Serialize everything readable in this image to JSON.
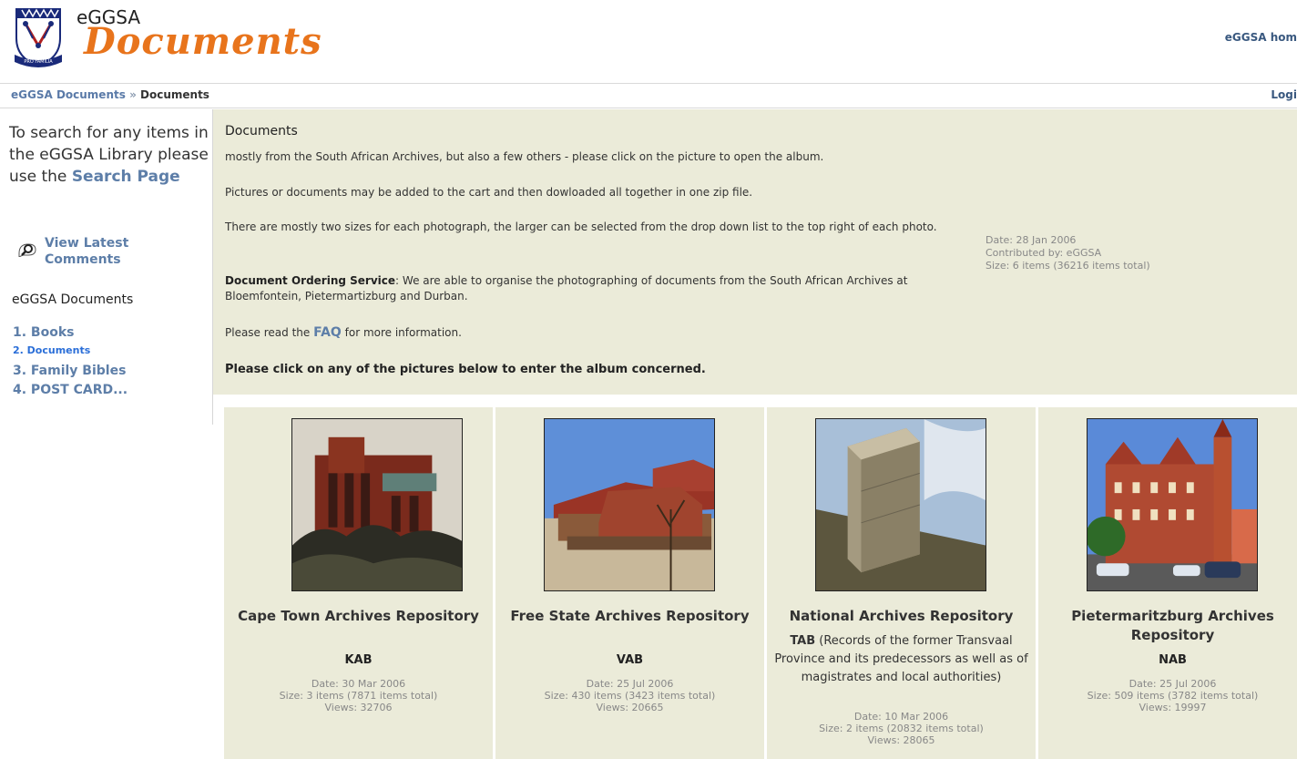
{
  "header": {
    "logo_small": "eGGSA",
    "logo_big": "Documents",
    "home_link": "eGGSA hom",
    "crest_motto": "PRO FAMILIA"
  },
  "breadcrumb": {
    "root": "eGGSA Documents",
    "separator": "»",
    "current": "Documents",
    "login": "Logi"
  },
  "sidebar": {
    "search_text": "To search for any items in the eGGSA Library please use the",
    "search_link": "Search Page",
    "latest_link": "View Latest Comments",
    "section_title": "eGGSA Documents",
    "items": [
      {
        "label": "1. Books"
      },
      {
        "label": "2. Documents"
      },
      {
        "label": "3. Family Bibles"
      },
      {
        "label": "4. POST CARD..."
      }
    ]
  },
  "intro": {
    "heading": "Documents",
    "p1": "mostly from the South African Archives, but also a few others - please click on the picture to open the album.",
    "p2": "Pictures or documents may be added to the cart and then dowloaded all together in one zip file.",
    "p3": "There are mostly two sizes for each photograph, the larger can be selected from the drop down list to the top right of each photo.",
    "p4_bold": "Document Ordering Service",
    "p4_rest": ": We are able to organise the photographing of documents from the South African Archives at Bloemfontein, Pietermartizburg and Durban.",
    "p5_pre": "Please read the ",
    "p5_link": "FAQ",
    "p5_post": " for more information.",
    "p6": "Please click on any of the pictures below to enter the album concerned.",
    "meta_date": "Date: 28 Jan 2006",
    "meta_contrib": "Contributed by: eGGSA",
    "meta_size": "Size: 6 items (36216 items total)"
  },
  "albums": [
    {
      "title": "Cape Town Archives Repository",
      "code": "KAB",
      "date": "Date: 30 Mar 2006",
      "size": "Size: 3 items (7871 items total)",
      "views": "Views: 32706"
    },
    {
      "title": "Free State Archives Repository",
      "code": "VAB",
      "date": "Date: 25 Jul 2006",
      "size": "Size: 430 items (3423 items total)",
      "views": "Views: 20665"
    },
    {
      "title": "National Archives Repository",
      "code": "TAB",
      "code_desc": " (Records of the former Transvaal Province and its predecessors as well as of magistrates and local authorities)",
      "date": "Date: 10 Mar 2006",
      "size": "Size: 2 items (20832 items total)",
      "views": "Views: 28065"
    },
    {
      "title": "Pietermaritzburg Archives Repository",
      "code": "NAB",
      "date": "Date: 25 Jul 2006",
      "size": "Size: 509 items (3782 items total)",
      "views": "Views: 19997"
    }
  ]
}
